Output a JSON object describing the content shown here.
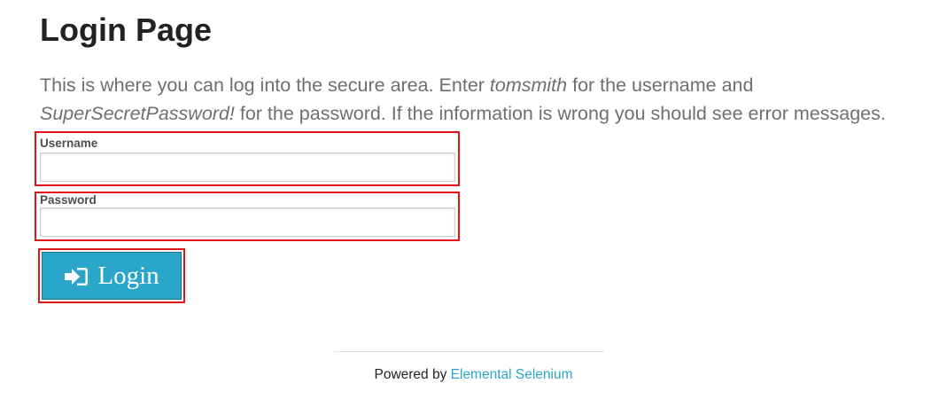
{
  "page": {
    "title": "Login Page"
  },
  "intro": {
    "part1": "This is where you can log into the secure area. Enter ",
    "username_hint": "tomsmith",
    "part2": " for the username and ",
    "password_hint": "SuperSecretPassword!",
    "part3": " for the password. If the information is wrong you should see error messages."
  },
  "form": {
    "username_label": "Username",
    "username_value": "",
    "password_label": "Password",
    "password_value": "",
    "login_label": "Login",
    "login_icon": "sign-in-icon"
  },
  "footer": {
    "prefix": "Powered by ",
    "link_text": "Elemental Selenium"
  },
  "colors": {
    "accent": "#2ba6cb",
    "highlight_border": "#e0161b"
  }
}
